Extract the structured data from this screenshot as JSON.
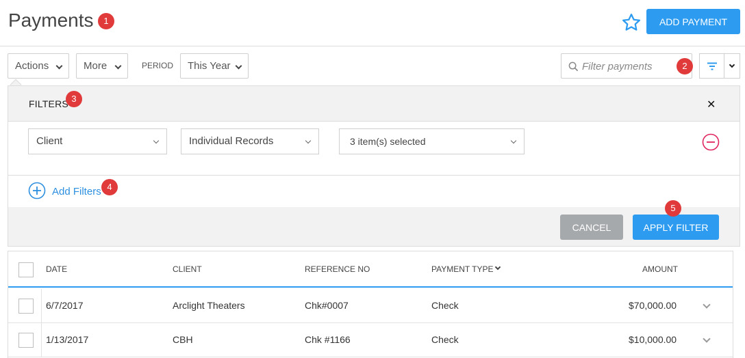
{
  "header": {
    "title": "Payments",
    "add_button": "ADD PAYMENT"
  },
  "badges": [
    "1",
    "2",
    "3",
    "4",
    "5"
  ],
  "toolbar": {
    "actions_label": "Actions",
    "more_label": "More",
    "period_label": "PERIOD",
    "period_value": "This Year",
    "search_placeholder": "Filter payments"
  },
  "filters": {
    "title": "FILTERS",
    "field": "Client",
    "mode": "Individual Records",
    "selection": "3 item(s) selected",
    "add_label": "Add Filters",
    "cancel_label": "CANCEL",
    "apply_label": "APPLY FILTER"
  },
  "table": {
    "columns": [
      "DATE",
      "CLIENT",
      "REFERENCE NO",
      "PAYMENT TYPE",
      "AMOUNT"
    ],
    "rows": [
      {
        "date": "6/7/2017",
        "client": "Arclight Theaters",
        "ref": "Chk#0007",
        "type": "Check",
        "amount": "$70,000.00"
      },
      {
        "date": "1/13/2017",
        "client": "CBH",
        "ref": "Chk #1166",
        "type": "Check",
        "amount": "$10,000.00"
      }
    ]
  },
  "colors": {
    "accent": "#2d9cf0",
    "badge": "#e03a3a",
    "remove": "#e0245e",
    "cancel": "#a6a9ac"
  }
}
